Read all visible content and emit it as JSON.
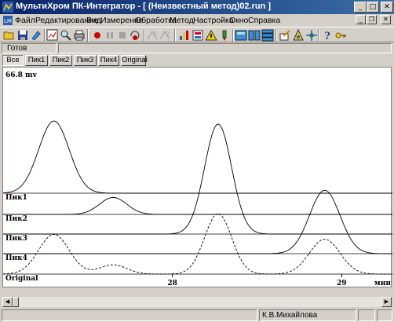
{
  "window": {
    "title": "МультиХром ПК-Интегратор - [ (Неизвестный метод)02.run ]"
  },
  "menu": [
    "Файл",
    "Редактирование",
    "Вид",
    "Измерение",
    "Обработка",
    "Метод",
    "Настройка",
    "Окно",
    "Справка"
  ],
  "toolbar": {
    "icons": [
      "open-icon",
      "save-icon",
      "layers-icon",
      "zoom-image-icon",
      "find-icon",
      "print-icon",
      "record-icon",
      "pause-icon",
      "stop-icon",
      "step-icon",
      "integrate-icon",
      "integrate-2-icon",
      "chart-icon",
      "report-icon",
      "warning-icon",
      "marker-icon",
      "layout-1-icon",
      "layout-2-icon",
      "layout-3-icon",
      "edit-icon",
      "settings-icon",
      "network-icon",
      "help-icon",
      "key-icon"
    ]
  },
  "status": {
    "text": "Готов"
  },
  "tabs": [
    "Все",
    "Пик1",
    "Пик2",
    "Пик3",
    "Пик4",
    "Original"
  ],
  "active_tab": "Все",
  "chart_data": {
    "type": "line",
    "ymax_label": "66.8 mv",
    "channels": [
      "Пик1",
      "Пик2",
      "Пик3",
      "Пик4",
      "Original"
    ],
    "x_ticks": [
      "28",
      "29"
    ],
    "x_unit": "мин",
    "xlim": [
      27.0,
      29.3
    ],
    "peaks": [
      {
        "name": "Пик1",
        "center": 27.3,
        "height": 1.0,
        "style": "solid"
      },
      {
        "name": "Пик2",
        "center": 27.65,
        "height": 0.45,
        "style": "solid"
      },
      {
        "name": "Пик3",
        "center": 28.27,
        "height": 1.0,
        "style": "solid"
      },
      {
        "name": "Пик4",
        "center": 28.9,
        "height": 0.85,
        "style": "solid"
      },
      {
        "name": "Original",
        "center": 28.27,
        "height": 1.0,
        "style": "dashed"
      }
    ]
  },
  "statusbar": {
    "user": "К.В.Михайлова",
    "field1": "",
    "field2": ""
  },
  "colors": {
    "titlebar": "#0a246a",
    "accent": "#3a6ea5",
    "record": "#cc0000"
  }
}
